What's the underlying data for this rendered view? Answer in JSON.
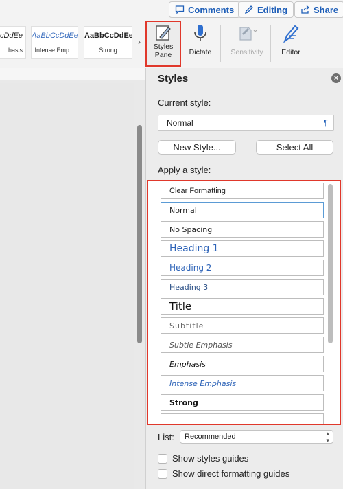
{
  "topbar": {
    "comments_label": "Comments",
    "editing_label": "Editing",
    "share_label": "Share"
  },
  "ribbon": {
    "gallery": [
      {
        "sample": "cDdEe",
        "label": "hasis"
      },
      {
        "sample": "AaBbCcDdEe",
        "label": "Intense Emp..."
      },
      {
        "sample": "AaBbCcDdEe",
        "label": "Strong"
      }
    ],
    "gallery_more": "›",
    "tools": {
      "styles_pane_line1": "Styles",
      "styles_pane_line2": "Pane",
      "dictate": "Dictate",
      "sensitivity": "Sensitivity",
      "editor": "Editor"
    }
  },
  "pane": {
    "title": "Styles",
    "close_glyph": "×",
    "current_style_label": "Current style:",
    "current_style_value": "Normal",
    "pilcrow": "¶",
    "new_style_button": "New Style...",
    "select_all_button": "Select All",
    "apply_label": "Apply a style:",
    "styles": [
      {
        "name": "Clear Formatting"
      },
      {
        "name": "Normal"
      },
      {
        "name": "No Spacing"
      },
      {
        "name": "Heading 1"
      },
      {
        "name": "Heading 2"
      },
      {
        "name": "Heading 3"
      },
      {
        "name": "Title"
      },
      {
        "name": "Subtitle"
      },
      {
        "name": "Subtle Emphasis"
      },
      {
        "name": "Emphasis"
      },
      {
        "name": "Intense Emphasis"
      },
      {
        "name": "Strong"
      },
      {
        "name": ""
      }
    ],
    "list_label": "List:",
    "list_value": "Recommended",
    "show_styles_guides": "Show styles guides",
    "show_direct_formatting_guides": "Show direct formatting guides"
  },
  "colors": {
    "accent_blue": "#1f5fb8",
    "highlight_red": "#e0382b"
  }
}
